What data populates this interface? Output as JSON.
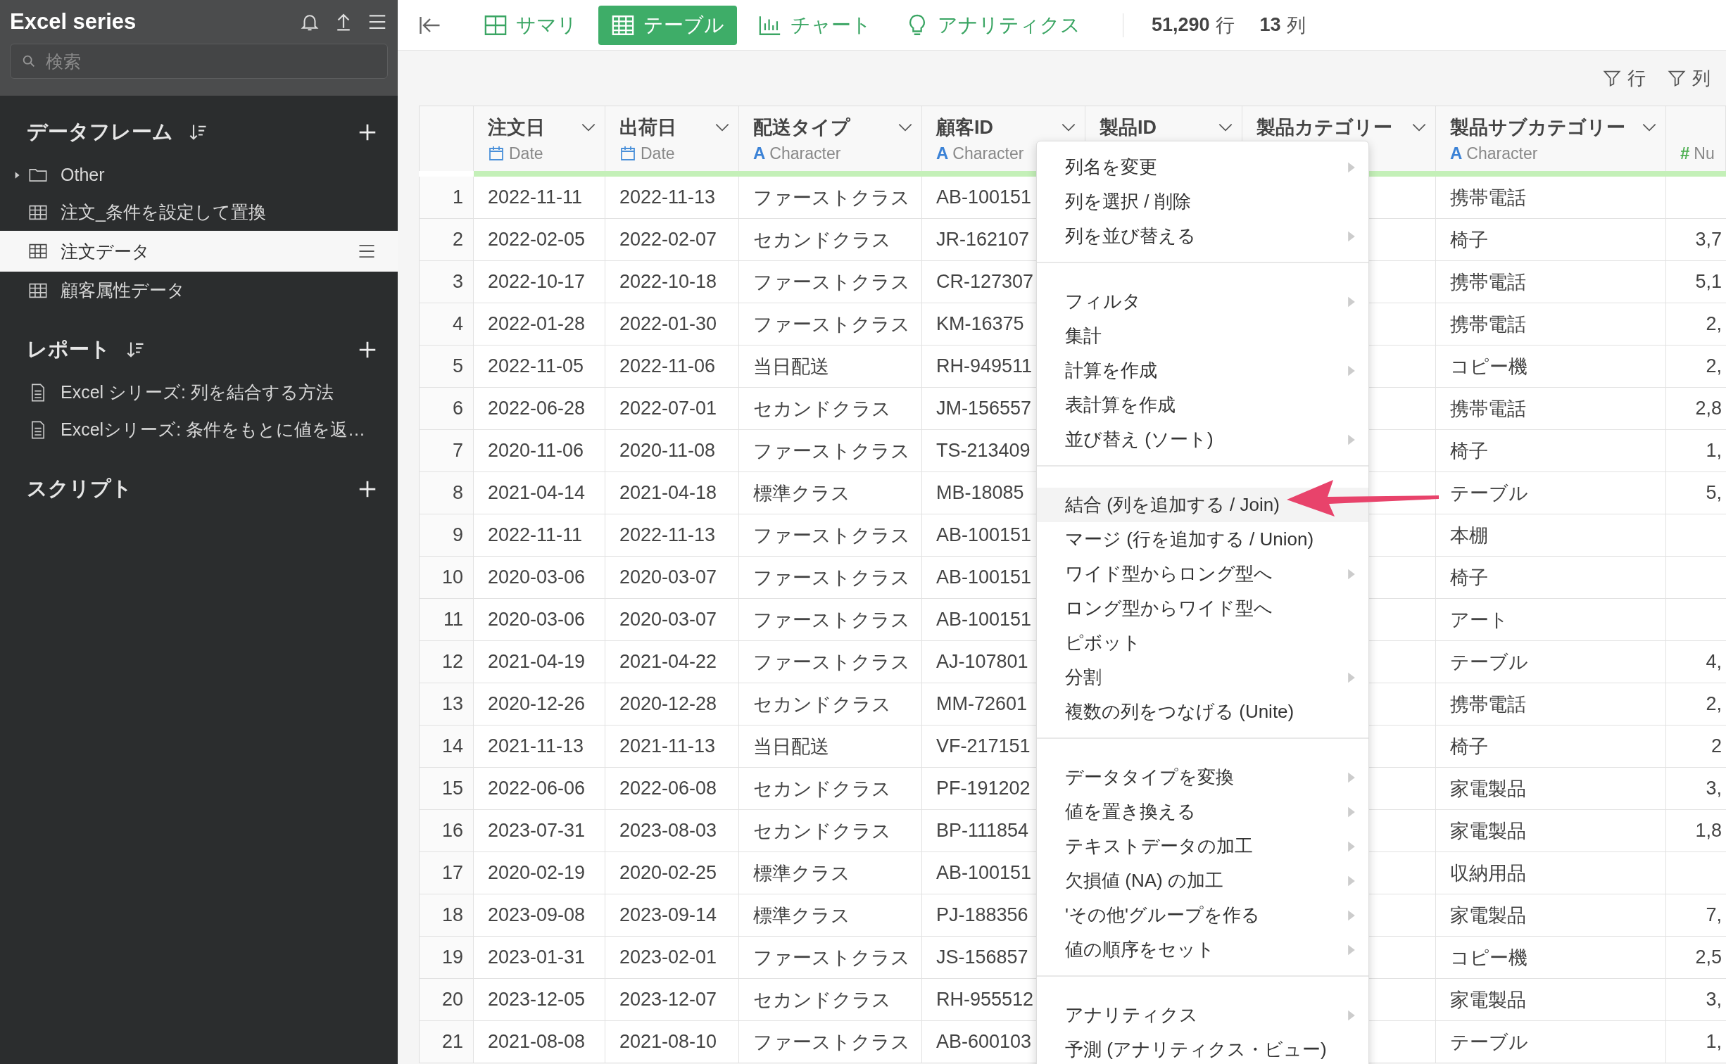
{
  "sidebar": {
    "title": "Excel series",
    "search": {
      "placeholder": "検索"
    },
    "sections": [
      {
        "title": "データフレーム",
        "sortable": true,
        "items": [
          {
            "kind": "folder",
            "label": "Other",
            "expanded": false,
            "selected": false
          },
          {
            "kind": "table",
            "label": "注文_条件を設定して置換",
            "selected": false
          },
          {
            "kind": "table",
            "label": "注文データ",
            "selected": true
          },
          {
            "kind": "table",
            "label": "顧客属性データ",
            "selected": false
          }
        ]
      },
      {
        "title": "レポート",
        "sortable": true,
        "items": [
          {
            "kind": "report",
            "label": "Excel シリーズ: 列を結合する方法",
            "selected": false
          },
          {
            "kind": "report",
            "label": "Excelシリーズ: 条件をもとに値を返…",
            "selected": false
          }
        ]
      },
      {
        "title": "スクリプト",
        "sortable": false
      }
    ]
  },
  "toolbar": {
    "tabs": [
      {
        "kind": "summary",
        "label": "サマリ",
        "selected": false
      },
      {
        "kind": "table",
        "label": "テーブル",
        "selected": true
      },
      {
        "kind": "chart",
        "label": "チャート",
        "selected": false
      },
      {
        "kind": "analytics",
        "label": "アナリティクス",
        "selected": false
      }
    ],
    "row_count": "51,290",
    "row_unit": "行",
    "column_count": "13",
    "column_unit": "列"
  },
  "filters": [
    "行",
    "列"
  ],
  "table": {
    "columns": [
      {
        "name": "注文日",
        "kind": "date",
        "type": "Date"
      },
      {
        "name": "出荷日",
        "kind": "date",
        "type": "Date"
      },
      {
        "name": "配送タイプ",
        "kind": "character",
        "type_icon": "A",
        "type": "Character"
      },
      {
        "name": "顧客ID",
        "kind": "character",
        "type_icon": "A",
        "type": "Character"
      },
      {
        "name": "製品ID"
      },
      {
        "name": "製品カテゴリー"
      },
      {
        "name": "製品サブカテゴリー",
        "kind": "character",
        "type_icon": "A",
        "type": "Character"
      },
      {
        "kind": "number",
        "type_icon": "#",
        "type": "Nu"
      }
    ],
    "rows": [
      {
        "number": "1",
        "order_date": "2022-11-11",
        "ship_date": "2022-11-13",
        "ship_type": "ファーストクラス",
        "customer_id": "AB-100151",
        "subcategory": "携帯電話"
      },
      {
        "number": "2",
        "order_date": "2022-02-05",
        "ship_date": "2022-02-07",
        "ship_type": "セカンドクラス",
        "customer_id": "JR-162107",
        "subcategory": "椅子",
        "column_8": "3,7"
      },
      {
        "number": "3",
        "order_date": "2022-10-17",
        "ship_date": "2022-10-18",
        "ship_type": "ファーストクラス",
        "customer_id": "CR-127307",
        "subcategory": "携帯電話",
        "column_8": "5,1"
      },
      {
        "number": "4",
        "order_date": "2022-01-28",
        "ship_date": "2022-01-30",
        "ship_type": "ファーストクラス",
        "customer_id": "KM-16375",
        "subcategory": "携帯電話",
        "column_8": "2,"
      },
      {
        "number": "5",
        "order_date": "2022-11-05",
        "ship_date": "2022-11-06",
        "ship_type": "当日配送",
        "customer_id": "RH-949511",
        "subcategory": "コピー機",
        "column_8": "2,"
      },
      {
        "number": "6",
        "order_date": "2022-06-28",
        "ship_date": "2022-07-01",
        "ship_type": "セカンドクラス",
        "customer_id": "JM-156557",
        "subcategory": "携帯電話",
        "column_8": "2,8"
      },
      {
        "number": "7",
        "order_date": "2020-11-06",
        "ship_date": "2020-11-08",
        "ship_type": "ファーストクラス",
        "customer_id": "TS-213409",
        "subcategory": "椅子",
        "column_8": "1,"
      },
      {
        "number": "8",
        "order_date": "2021-04-14",
        "ship_date": "2021-04-18",
        "ship_type": "標準クラス",
        "customer_id": "MB-18085",
        "subcategory": "テーブル",
        "column_8": "5,"
      },
      {
        "number": "9",
        "order_date": "2022-11-11",
        "ship_date": "2022-11-13",
        "ship_type": "ファーストクラス",
        "customer_id": "AB-100151",
        "subcategory": "本棚"
      },
      {
        "number": "10",
        "order_date": "2020-03-06",
        "ship_date": "2020-03-07",
        "ship_type": "ファーストクラス",
        "customer_id": "AB-100151",
        "subcategory": "椅子"
      },
      {
        "number": "11",
        "order_date": "2020-03-06",
        "ship_date": "2020-03-07",
        "ship_type": "ファーストクラス",
        "customer_id": "AB-100151",
        "subcategory": "アート"
      },
      {
        "number": "12",
        "order_date": "2021-04-19",
        "ship_date": "2021-04-22",
        "ship_type": "ファーストクラス",
        "customer_id": "AJ-107801",
        "subcategory": "テーブル",
        "column_8": "4,"
      },
      {
        "number": "13",
        "order_date": "2020-12-26",
        "ship_date": "2020-12-28",
        "ship_type": "セカンドクラス",
        "customer_id": "MM-72601",
        "subcategory": "携帯電話",
        "column_8": "2,"
      },
      {
        "number": "14",
        "order_date": "2021-11-13",
        "ship_date": "2021-11-13",
        "ship_type": "当日配送",
        "customer_id": "VF-217151",
        "subcategory": "椅子",
        "column_8": "2"
      },
      {
        "number": "15",
        "order_date": "2022-06-06",
        "ship_date": "2022-06-08",
        "ship_type": "セカンドクラス",
        "customer_id": "PF-191202",
        "subcategory": "家電製品",
        "column_8": "3,"
      },
      {
        "number": "16",
        "order_date": "2023-07-31",
        "ship_date": "2023-08-03",
        "ship_type": "セカンドクラス",
        "customer_id": "BP-111854",
        "subcategory": "家電製品",
        "column_8": "1,8"
      },
      {
        "number": "17",
        "order_date": "2020-02-19",
        "ship_date": "2020-02-25",
        "ship_type": "標準クラス",
        "customer_id": "AB-100151",
        "subcategory": "収納用品"
      },
      {
        "number": "18",
        "order_date": "2023-09-08",
        "ship_date": "2023-09-14",
        "ship_type": "標準クラス",
        "customer_id": "PJ-188356",
        "subcategory": "家電製品",
        "column_8": "7,"
      },
      {
        "number": "19",
        "order_date": "2023-01-31",
        "ship_date": "2023-02-01",
        "ship_type": "ファーストクラス",
        "customer_id": "JS-156857",
        "subcategory": "コピー機",
        "column_8": "2,5"
      },
      {
        "number": "20",
        "order_date": "2023-12-05",
        "ship_date": "2023-12-07",
        "ship_type": "セカンドクラス",
        "customer_id": "RH-955512",
        "subcategory": "家電製品",
        "column_8": "3,"
      },
      {
        "number": "21",
        "order_date": "2021-08-08",
        "ship_date": "2021-08-10",
        "ship_type": "ファーストクラス",
        "customer_id": "AB-600103",
        "subcategory": "テーブル",
        "column_8": "1,"
      }
    ]
  },
  "context_menu": {
    "groups": [
      [
        {
          "label": "列名を変更",
          "submenu": true,
          "selected": false
        },
        {
          "label": "列を選択 / 削除",
          "submenu": false,
          "selected": false
        },
        {
          "label": "列を並び替える",
          "submenu": true,
          "selected": false
        }
      ],
      [
        {
          "label": "フィルタ",
          "submenu": true,
          "selected": false
        },
        {
          "label": "集計",
          "submenu": false,
          "selected": false
        },
        {
          "label": "計算を作成",
          "submenu": true,
          "selected": false
        },
        {
          "label": "表計算を作成",
          "submenu": false,
          "selected": false
        },
        {
          "label": "並び替え (ソート)",
          "submenu": true,
          "selected": false
        }
      ],
      [
        {
          "label": "結合 (列を追加する / Join)",
          "submenu": false,
          "selected": true
        },
        {
          "label": "マージ (行を追加する / Union)",
          "submenu": false,
          "selected": false
        },
        {
          "label": "ワイド型からロング型へ",
          "submenu": true,
          "selected": false
        },
        {
          "label": "ロング型からワイド型へ",
          "submenu": false,
          "selected": false
        },
        {
          "label": "ピボット",
          "submenu": false,
          "selected": false
        },
        {
          "label": "分割",
          "submenu": true,
          "selected": false
        },
        {
          "label": "複数の列をつなげる (Unite)",
          "submenu": false,
          "selected": false
        }
      ],
      [
        {
          "label": "データタイプを変換",
          "submenu": true,
          "selected": false
        },
        {
          "label": "値を置き換える",
          "submenu": true,
          "selected": false
        },
        {
          "label": "テキストデータの加工",
          "submenu": true,
          "selected": false
        },
        {
          "label": "欠損値 (NA) の加工",
          "submenu": true,
          "selected": false
        },
        {
          "label": "'その他'グループを作る",
          "submenu": true,
          "selected": false
        },
        {
          "label": "値の順序をセット",
          "submenu": true,
          "selected": false
        }
      ],
      [
        {
          "label": "アナリティクス",
          "submenu": true,
          "selected": false
        },
        {
          "label": "予測 (アナリティクス・ビュー)",
          "submenu": false,
          "selected": false
        }
      ]
    ]
  }
}
